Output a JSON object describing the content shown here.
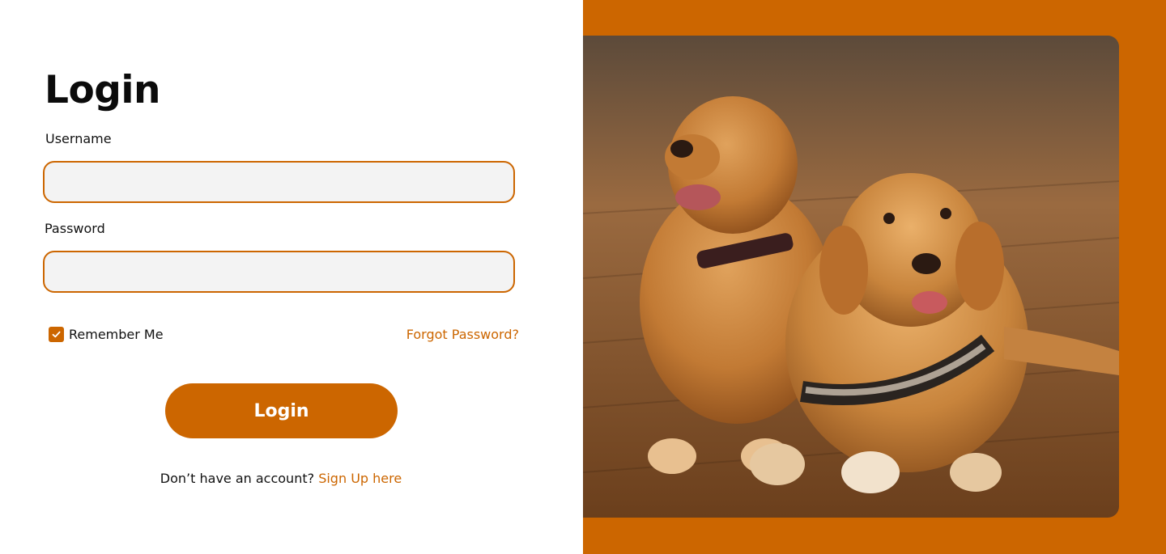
{
  "login": {
    "title": "Login",
    "username_label": "Username",
    "username_value": "",
    "password_label": "Password",
    "password_value": "",
    "remember_label": "Remember Me",
    "remember_checked": true,
    "forgot_label": "Forgot Password?",
    "submit_label": "Login",
    "signup_prompt": "Don’t have an account?",
    "signup_link": "Sign Up here"
  },
  "hero": {
    "image_subject": "two golden retrievers lying on wooden floor"
  },
  "colors": {
    "accent": "#cc6600",
    "field_bg": "#f3f3f3",
    "text": "#111111"
  },
  "icons": {
    "checkbox": "check-icon"
  }
}
